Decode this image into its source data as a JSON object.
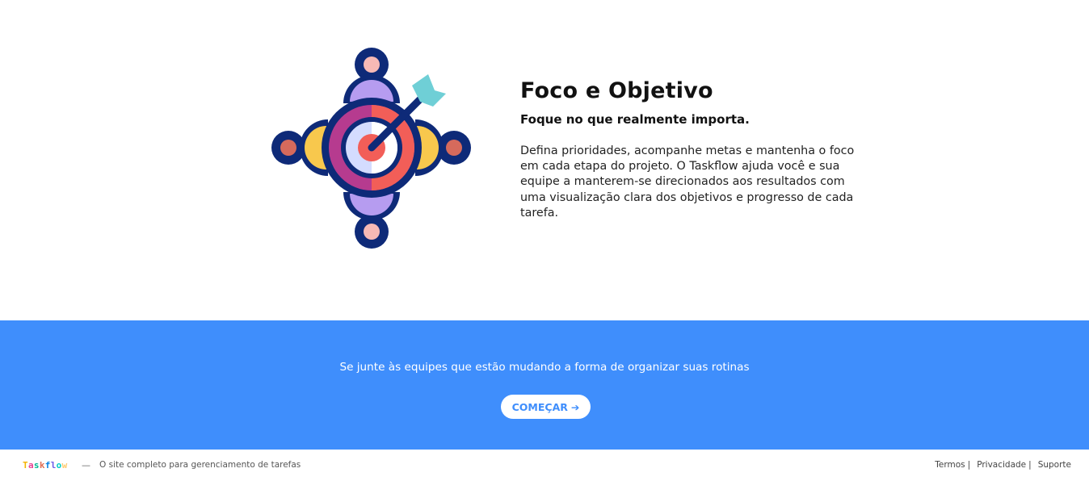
{
  "feature": {
    "title": "Foco e Objetivo",
    "subtitle": "Foque no que realmente importa.",
    "body": "Defina prioridades, acompanhe metas e mantenha o foco em cada etapa do projeto. O Taskflow ajuda você e sua equipe a manterem-se direcionados aos resultados com uma visualização clara dos objetivos e progresso de cada tarefa.",
    "illustration_icon": "target-arrow-icon"
  },
  "cta": {
    "text": "Se junte às equipes que estão mudando a forma de organizar suas rotinas",
    "button_label": "COMEÇAR",
    "button_icon": "arrow-right-icon",
    "button_arrow": "➔",
    "background_color": "#3f8efc"
  },
  "footer": {
    "logo_letters": [
      "T",
      "a",
      "s",
      "k",
      "f",
      "l",
      "o",
      "w"
    ],
    "logo_colors": [
      "#f4b400",
      "#e84393",
      "#00b894",
      "#e17055",
      "#0984e3",
      "#6c5ce7",
      "#00cec9",
      "#fdcb6e"
    ],
    "dash": "—",
    "tagline": "O site completo para gerenciamento de tarefas",
    "links": [
      {
        "label": "Termos",
        "separator": "|"
      },
      {
        "label": "Privacidade",
        "separator": "|"
      },
      {
        "label": "Suporte",
        "separator": ""
      }
    ]
  }
}
